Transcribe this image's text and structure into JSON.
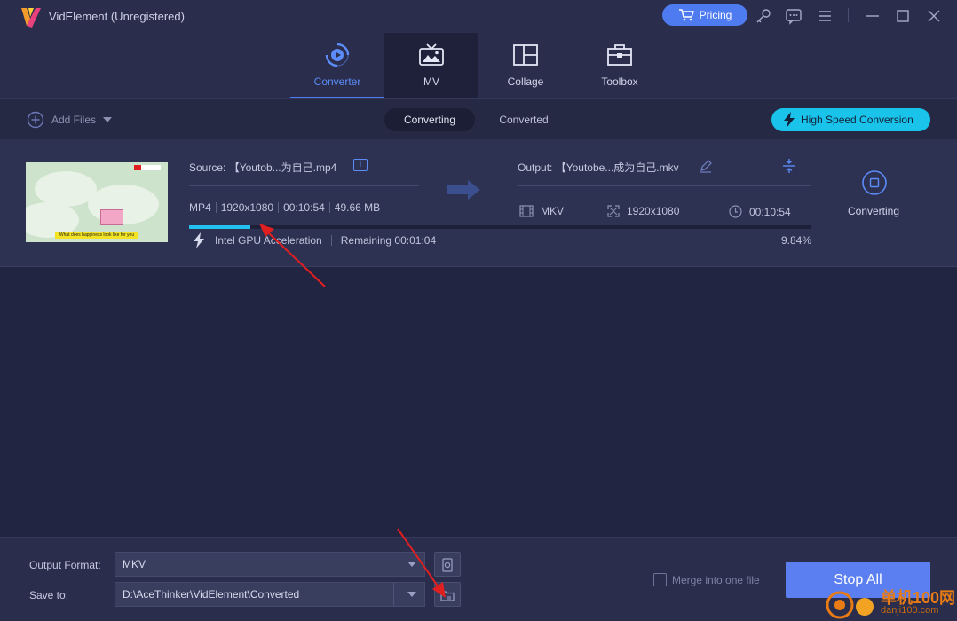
{
  "window": {
    "title": "VidElement (Unregistered)",
    "pricing_label": "Pricing",
    "controls": [
      "key-icon",
      "feedback-icon",
      "menu-icon",
      "minimize-icon",
      "maximize-icon",
      "close-icon"
    ]
  },
  "nav": {
    "tabs": [
      {
        "label": "Converter",
        "icon": "converter-icon",
        "active": true
      },
      {
        "label": "MV",
        "icon": "mv-icon",
        "active": false
      },
      {
        "label": "Collage",
        "icon": "collage-icon",
        "active": false
      },
      {
        "label": "Toolbox",
        "icon": "toolbox-icon",
        "active": false
      }
    ]
  },
  "toolbar": {
    "add_files_label": "Add Files",
    "filter_tabs": [
      "Converting",
      "Converted"
    ],
    "active_filter": "Converting",
    "high_speed_label": "High Speed Conversion"
  },
  "task": {
    "source_label": "Source:",
    "source_name": "【Youtob...为自己.mp4",
    "source_format": "MP4",
    "source_resolution": "1920x1080",
    "source_duration": "00:10:54",
    "source_size": "49.66 MB",
    "output_label": "Output:",
    "output_name": "【Youtobe...成为自己.mkv",
    "output_format": "MKV",
    "output_resolution": "1920x1080",
    "output_duration": "00:10:54",
    "status": "Converting",
    "acceleration": "Intel GPU Acceleration",
    "remaining": "Remaining 00:01:04",
    "progress_percent_label": "9.84%",
    "progress_fraction": 0.0984,
    "thumbnail_caption": "What does happiness look like for you"
  },
  "bottom": {
    "output_format_label": "Output Format:",
    "output_format_value": "MKV",
    "save_to_label": "Save to:",
    "save_to_value": "D:\\AceThinker\\VidElement\\Converted",
    "merge_label": "Merge into one file",
    "merge_checked": false,
    "stop_all_label": "Stop All"
  },
  "watermark": {
    "line1": "单机100网",
    "line2": "danji100.com"
  },
  "colors": {
    "background": "#222541",
    "accent": "#4f7bf0",
    "progress": "#22c1ef",
    "high_speed": "#19c3ea",
    "annotation_arrow": "#e02020"
  }
}
